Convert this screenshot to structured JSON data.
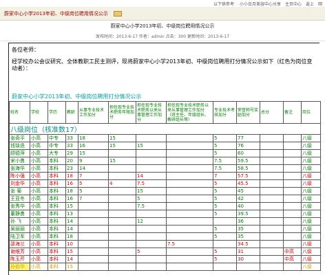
{
  "topbar": {
    "items": [
      "以下供参考·",
      "小小日月美容中心分享",
      "主页中心",
      "返上",
      "网"
    ]
  },
  "titlebar": {
    "title": "蔚家中心小学2013年初、中级岗位聘用情况公示"
  },
  "article": {
    "heading": "蔚家中心小学2013年初、中级岗位聘用情况公示",
    "meta": "发布时间：2013-6-17  作者：admin  点击：300  更新时间：2013-6-17"
  },
  "body": {
    "greeting": "各位老师：",
    "intro": "经学校办公会议研究、全体教职工民主测评，现将蔚家中心小学2013年初、中级岗位聘用打分情况公示如下（红色为岗位变动者）：",
    "table_title": "蔚家中心小学2013年初、中级岗位聘用打分情况公示"
  },
  "table": {
    "headers": [
      "姓名",
      "学校",
      "学历",
      "教龄",
      "从事专业技术工作加分",
      "担任现专业技术职务年限加分",
      "担任现专业技术职务以来从事管理工作加分",
      "担任现专业技术职务以来从事管理工作加分（班主任、年级组长、教研组长等）",
      "专业技术考核加分",
      "荣誉称号奖励加分",
      "总分",
      "备注",
      "岗位"
    ],
    "section": "八级岗位（核准数17）",
    "rows": [
      {
        "c": [
          "张奇平",
          "小高",
          "中专",
          "33",
          "18",
          "15",
          "",
          "",
          "5",
          "77",
          "",
          "",
          "八级"
        ],
        "style": "g"
      },
      {
        "c": [
          "钱琰迭",
          "小高",
          "中专",
          "33",
          "16",
          "15",
          "15",
          "",
          "5",
          "76",
          "",
          "",
          "八级"
        ],
        "style": "g"
      },
      {
        "c": [
          "顾德萍",
          "小高",
          "大专",
          "29",
          "15",
          "",
          "",
          "",
          "5",
          "60",
          "",
          "",
          "八级"
        ],
        "style": "g"
      },
      {
        "c": [
          "宋小勇",
          "小高",
          "本科",
          "20",
          "9",
          "15",
          "",
          "",
          "7.5",
          "59.5",
          "",
          "",
          "八级"
        ],
        "style": "g"
      },
      {
        "c": [
          "张海华",
          "小高",
          "本科",
          "23",
          "14",
          "",
          "",
          "",
          "7.5",
          "58.5",
          "",
          "",
          "八级"
        ],
        "style": "g"
      },
      {
        "c": [
          "陈小强",
          "小高",
          "本科",
          "18",
          "7",
          "",
          "14",
          "",
          "7",
          "57.5",
          "",
          "",
          "八级"
        ],
        "style": "r"
      },
      {
        "c": [
          "刘金华",
          "小高",
          "本科",
          "16",
          "5",
          "4",
          "7.5",
          "",
          "5",
          "45.5",
          "",
          "",
          "八级"
        ],
        "style": "r"
      },
      {
        "c": [
          "张 菊",
          "小高",
          "本科",
          "18",
          "5",
          "",
          "15",
          "",
          "5",
          "45",
          "",
          "",
          "八级"
        ],
        "style": "g"
      },
      {
        "c": [
          "王亚冬",
          "小高",
          "本科",
          "16",
          "7",
          "",
          "5",
          "",
          "5",
          "42",
          "",
          "",
          "八级"
        ],
        "style": "g"
      },
      {
        "c": [
          "张秀华",
          "小高",
          "本科",
          "15",
          "",
          "",
          "7.5",
          "",
          "5",
          "40",
          "",
          "",
          "八级"
        ],
        "style": "g"
      },
      {
        "c": [
          "董静勇",
          "小高",
          "本科",
          "13",
          "",
          "",
          "",
          "",
          "5",
          "39.5",
          "",
          "",
          "八级"
        ],
        "style": "g"
      },
      {
        "c": [
          "孙 飞",
          "小高",
          "本科",
          "14",
          "",
          "",
          "12",
          "",
          "",
          "36",
          "",
          "",
          "八级"
        ],
        "style": "g"
      },
      {
        "c": [
          "吴丽丽",
          "小高",
          "本科",
          "14",
          "",
          "",
          "",
          "",
          "5",
          "35",
          "",
          "",
          "八级"
        ],
        "style": "g"
      },
      {
        "c": [
          "陆卫军",
          "小高",
          "本科",
          "18",
          "",
          "",
          "",
          "",
          "5",
          "35",
          "",
          "",
          "八级"
        ],
        "style": "g"
      },
      {
        "c": [
          "邵海兰",
          "小高",
          "本科",
          "10",
          "",
          "",
          "",
          "7.5",
          "",
          "34.5",
          "",
          "",
          "八级"
        ],
        "style": "r"
      },
      {
        "c": [
          "谢维芳",
          "小高",
          "本科",
          "15",
          "",
          "",
          "5",
          "",
          "5",
          "31",
          "",
          "中高",
          "八级"
        ],
        "style": "r"
      },
      {
        "c": [
          "陈玉芹",
          "小高",
          "本科",
          "14",
          "",
          "",
          "",
          "",
          "5",
          "30",
          "",
          "中高",
          "八级"
        ],
        "style": "r"
      },
      {
        "c": [
          "孙伯华",
          "小高",
          "本科",
          "15",
          "",
          "",
          "",
          "",
          "",
          "",
          "",
          "",
          "八级"
        ],
        "style": "y"
      }
    ]
  },
  "colors": {
    "green": "#008000",
    "red": "#d00000",
    "cyan": "#0a8a8a",
    "title_red": "#a30000"
  }
}
